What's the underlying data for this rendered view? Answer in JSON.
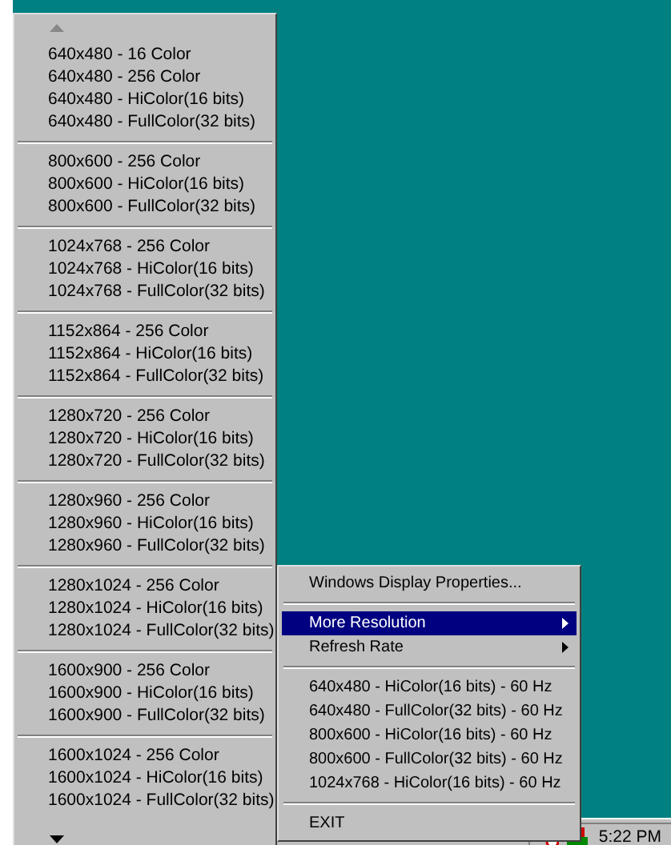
{
  "resolution_menu": {
    "groups": [
      [
        "640x480 - 16 Color",
        "640x480 - 256 Color",
        "640x480 - HiColor(16 bits)",
        "640x480 - FullColor(32 bits)"
      ],
      [
        "800x600 - 256 Color",
        "800x600 - HiColor(16 bits)",
        "800x600 - FullColor(32 bits)"
      ],
      [
        "1024x768 - 256 Color",
        "1024x768 - HiColor(16 bits)",
        "1024x768 - FullColor(32 bits)"
      ],
      [
        "1152x864 - 256 Color",
        "1152x864 - HiColor(16 bits)",
        "1152x864 - FullColor(32 bits)"
      ],
      [
        "1280x720 - 256 Color",
        "1280x720 - HiColor(16 bits)",
        "1280x720 - FullColor(32 bits)"
      ],
      [
        "1280x960 - 256 Color",
        "1280x960 - HiColor(16 bits)",
        "1280x960 - FullColor(32 bits)"
      ],
      [
        "1280x1024 - 256 Color",
        "1280x1024 - HiColor(16 bits)",
        "1280x1024 - FullColor(32 bits)"
      ],
      [
        "1600x900 - 256 Color",
        "1600x900 - HiColor(16 bits)",
        "1600x900 - FullColor(32 bits)"
      ],
      [
        "1600x1024 - 256 Color",
        "1600x1024 - HiColor(16 bits)",
        "1600x1024 - FullColor(32 bits)"
      ]
    ]
  },
  "context_menu": {
    "items": [
      {
        "kind": "item",
        "label": "Windows Display Properties...",
        "selected": false
      },
      {
        "kind": "separator"
      },
      {
        "kind": "submenu",
        "label": "More Resolution",
        "selected": true
      },
      {
        "kind": "submenu",
        "label": "Refresh Rate",
        "selected": false
      },
      {
        "kind": "separator"
      },
      {
        "kind": "item",
        "label": "640x480 - HiColor(16 bits) - 60 Hz",
        "selected": false
      },
      {
        "kind": "item",
        "label": "640x480 - FullColor(32 bits) - 60 Hz",
        "selected": false
      },
      {
        "kind": "item",
        "label": "800x600 - HiColor(16 bits) - 60 Hz",
        "selected": false
      },
      {
        "kind": "item",
        "label": "800x600 - FullColor(32 bits) - 60 Hz",
        "selected": false
      },
      {
        "kind": "item",
        "label": "1024x768 - HiColor(16 bits) - 60 Hz",
        "selected": false
      },
      {
        "kind": "separator"
      },
      {
        "kind": "item",
        "label": "EXIT",
        "selected": false
      }
    ]
  },
  "taskbar": {
    "clock": "5:22 PM"
  }
}
